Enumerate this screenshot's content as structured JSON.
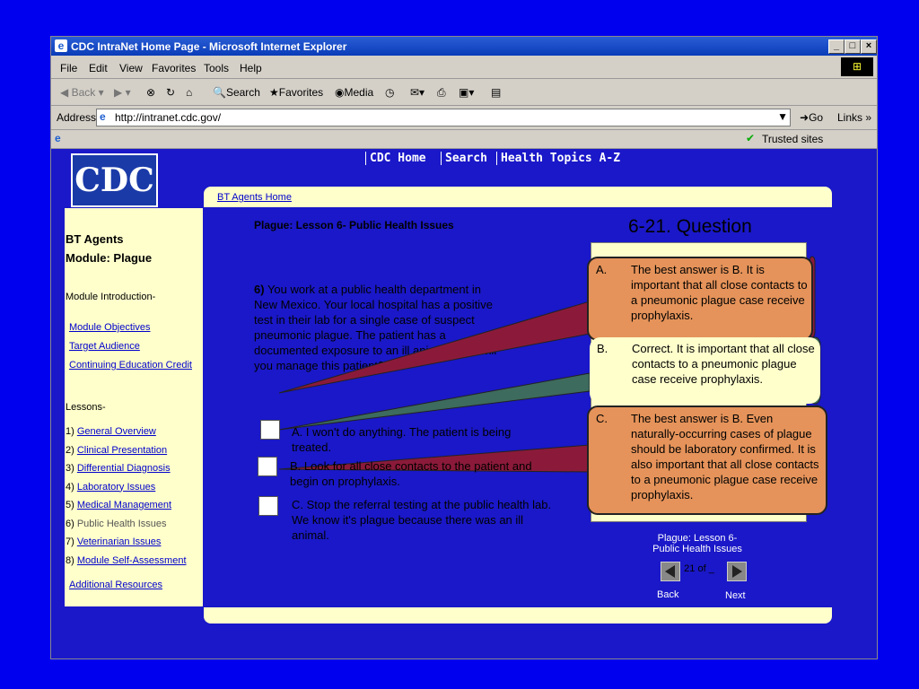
{
  "window": {
    "title": "CDC IntraNet Home Page - Microsoft Internet Explorer",
    "controls": [
      "_",
      "□",
      "×"
    ]
  },
  "menu": [
    "File",
    "Edit",
    "View",
    "Favorites",
    "Tools",
    "Help"
  ],
  "toolbar": {
    "back": "Back",
    "search": "Search",
    "favorites": "Favorites",
    "media": "Media"
  },
  "address": {
    "label": "Address",
    "url": "http://intranet.cdc.gov/",
    "go": "Go",
    "links": "Links"
  },
  "status": {
    "zone": "Trusted sites"
  },
  "site": {
    "logo": "CDC",
    "nav": [
      "CDC Home",
      "Search",
      "Health Topics A-Z"
    ],
    "breadcrumb": "BT Agents Home"
  },
  "sidebar": {
    "title1": "BT Agents",
    "title2": "Module: Plague",
    "intro_label": "Module Introduction-",
    "intro_links": [
      "Module Objectives",
      "Target Audience",
      "Continuing Education Credit"
    ],
    "lessons_label": "Lessons-",
    "lessons": [
      {
        "num": "1)",
        "label": "General Overview",
        "link": true
      },
      {
        "num": "2)",
        "label": "Clinical Presentation",
        "link": true
      },
      {
        "num": "3)",
        "label": "Differential Diagnosis",
        "link": true
      },
      {
        "num": "4)",
        "label": "Laboratory Issues",
        "link": true
      },
      {
        "num": "5)",
        "label": "Medical Management",
        "link": true
      },
      {
        "num": "6)",
        "label": "Public Health Issues",
        "link": false
      },
      {
        "num": "7)",
        "label": "Veterinarian Issues",
        "link": true
      },
      {
        "num": "8)",
        "label": "Module Self-Assessment",
        "link": true
      }
    ],
    "additional": "Additional Resources"
  },
  "lesson": {
    "heading": "Plague: Lesson 6- Public Health Issues",
    "question_title": "6-21. Question",
    "question_num": "6)",
    "question_text": "You work at a public health department in New Mexico.  Your local hospital has a positive test in their lab for a single case of suspect pneumonic plague.  The patient has a documented exposure to an ill animal.  How will you manage this patient?",
    "options": [
      "A. I won't do anything.  The patient is being treated.",
      "B. Look for all close contacts to the patient and begin on prophylaxis.",
      "C. Stop the referral testing at the public health lab.  We know it's plague because there was an ill animal."
    ]
  },
  "feedback": [
    {
      "letter": "A.",
      "text": "The best answer is B.  It is important that all close contacts to a pneumonic plague case receive prophylaxis."
    },
    {
      "letter": "B.",
      "text": "Correct. It is important that all close contacts to a pneumonic plague case receive prophylaxis."
    },
    {
      "letter": "C.",
      "text": "The best answer is B.  Even naturally-occurring cases of plague should be laboratory confirmed. It is also important that all close contacts to a pneumonic plague case receive prophylaxis."
    }
  ],
  "pager": {
    "caption1": "Plague: Lesson 6-",
    "caption2": "Public Health Issues",
    "page": "21 of _",
    "back": "Back",
    "next": "Next"
  },
  "colors": {
    "background": "#0000EE",
    "panel": "#ffffcc",
    "callout_wrong": "#e5935a",
    "callout_right": "#ffffcc",
    "line_correct": "#3d6b5e",
    "line_wrong": "#8b1a3a"
  }
}
